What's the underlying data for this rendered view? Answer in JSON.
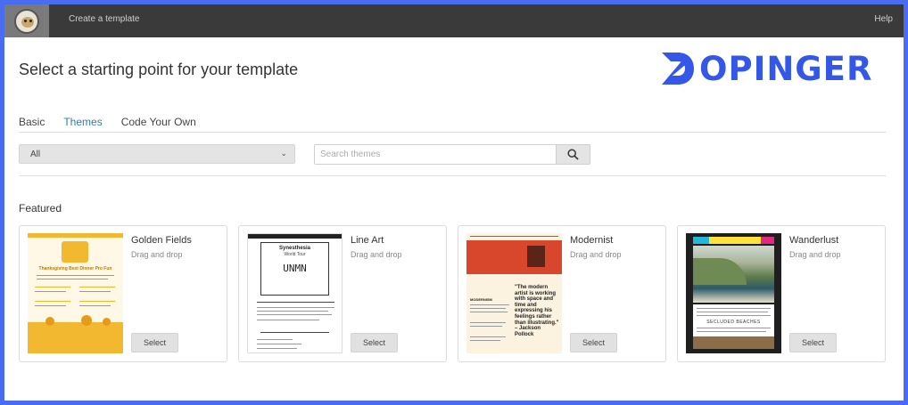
{
  "topbar": {
    "title": "Create a template",
    "help": "Help"
  },
  "page": {
    "title": "Select a starting point for your template"
  },
  "brand": {
    "text": "OPINGER",
    "color": "#3457e8"
  },
  "tabs": [
    {
      "label": "Basic",
      "active": false
    },
    {
      "label": "Themes",
      "active": true
    },
    {
      "label": "Code Your Own",
      "active": false
    }
  ],
  "filter": {
    "selected": "All"
  },
  "search": {
    "placeholder": "Search themes"
  },
  "featured": {
    "title": "Featured",
    "cards": [
      {
        "name": "Golden Fields",
        "subtitle": "Drag and drop",
        "button": "Select",
        "accent": "#f2b830"
      },
      {
        "name": "Line Art",
        "subtitle": "Drag and drop",
        "button": "Select",
        "accent": "#222222"
      },
      {
        "name": "Modernist",
        "subtitle": "Drag and drop",
        "button": "Select",
        "accent": "#d8462b"
      },
      {
        "name": "Wanderlust",
        "subtitle": "Drag and drop",
        "button": "Select",
        "accent": "#1f1f1f"
      }
    ]
  },
  "thumbs": {
    "golden_heading": "Thanksgiving Best Dinner Pro Fun",
    "lineart_heading": "Synesthesia",
    "lineart_sub": "World Tour",
    "lineart_logo": "UNMN",
    "modernist_heading": "MODERNISM",
    "modernist_quote": "\"The modern artist is working with space and time and expressing his feelings rather than illustrating.\" – Jackson Pollock",
    "wanderlust_heading": "SECLUDED BEACHES"
  }
}
